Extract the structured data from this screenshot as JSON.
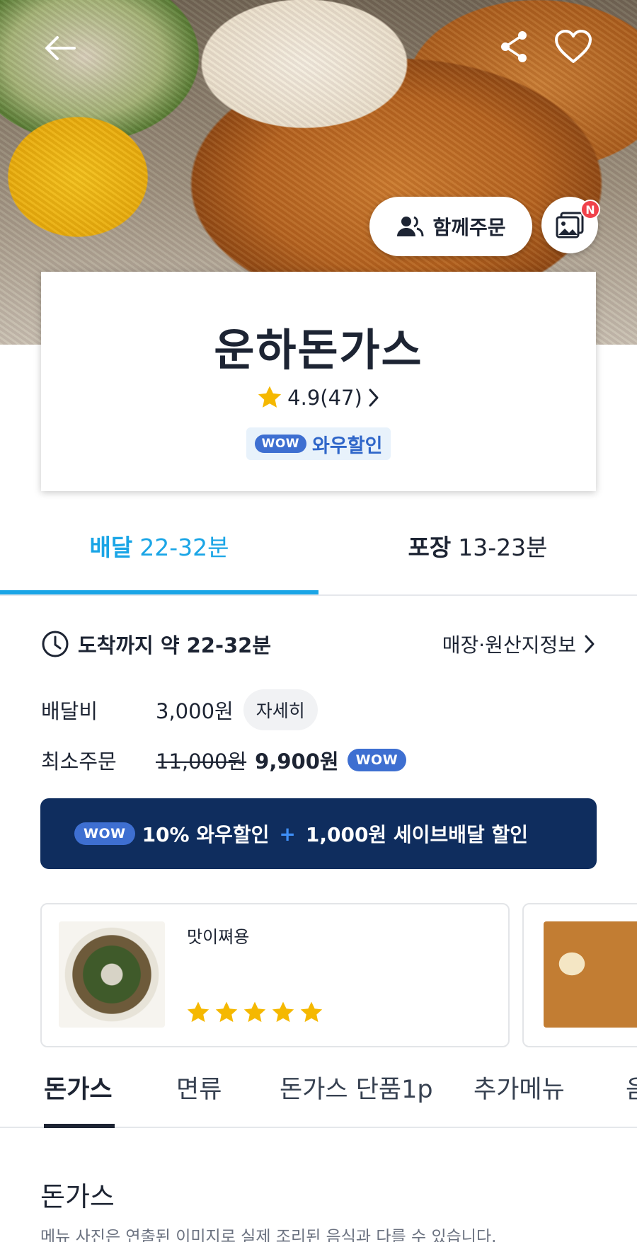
{
  "header": {
    "together_order_label": "함께주문",
    "photo_badge": "N"
  },
  "store": {
    "name": "운하돈가스",
    "rating": "4.9(47)",
    "wow_tag": "WOW",
    "wow_discount_label": "와우할인"
  },
  "delivery_tabs": [
    {
      "label": "배달",
      "time": "22-32분",
      "selected": true
    },
    {
      "label": "포장",
      "time": "13-23분",
      "selected": false
    }
  ],
  "info": {
    "arrival_text": "도착까지 약 22-32분",
    "store_origin_link": "매장·원산지정보",
    "delivery_fee_label": "배달비",
    "delivery_fee_value": "3,000원",
    "detail_button": "자세히",
    "min_order_label": "최소주문",
    "min_order_original": "11,000원",
    "min_order_discounted": "9,900원",
    "wow_tag": "WOW"
  },
  "promo": {
    "wow_tag": "WOW",
    "left_text": "10% 와우할인",
    "plus": "+",
    "right_text": "1,000원 세이브배달 할인"
  },
  "reviews": [
    {
      "text": "맛이쪄용",
      "stars": 5
    }
  ],
  "categories": [
    "돈가스",
    "면류",
    "돈가스 단품1p",
    "추가메뉴",
    "음"
  ],
  "active_category": 0,
  "section": {
    "title": "돈가스",
    "note": "메뉴 사진은 연출된 이미지로 실제 조리된 음식과 다를 수 있습니다."
  },
  "colors": {
    "accent_blue": "#1aa5e6",
    "wow_blue": "#3e6fd1",
    "promo_navy": "#0f2d5e",
    "star_yellow": "#f5b800",
    "badge_red": "#f0424b"
  }
}
